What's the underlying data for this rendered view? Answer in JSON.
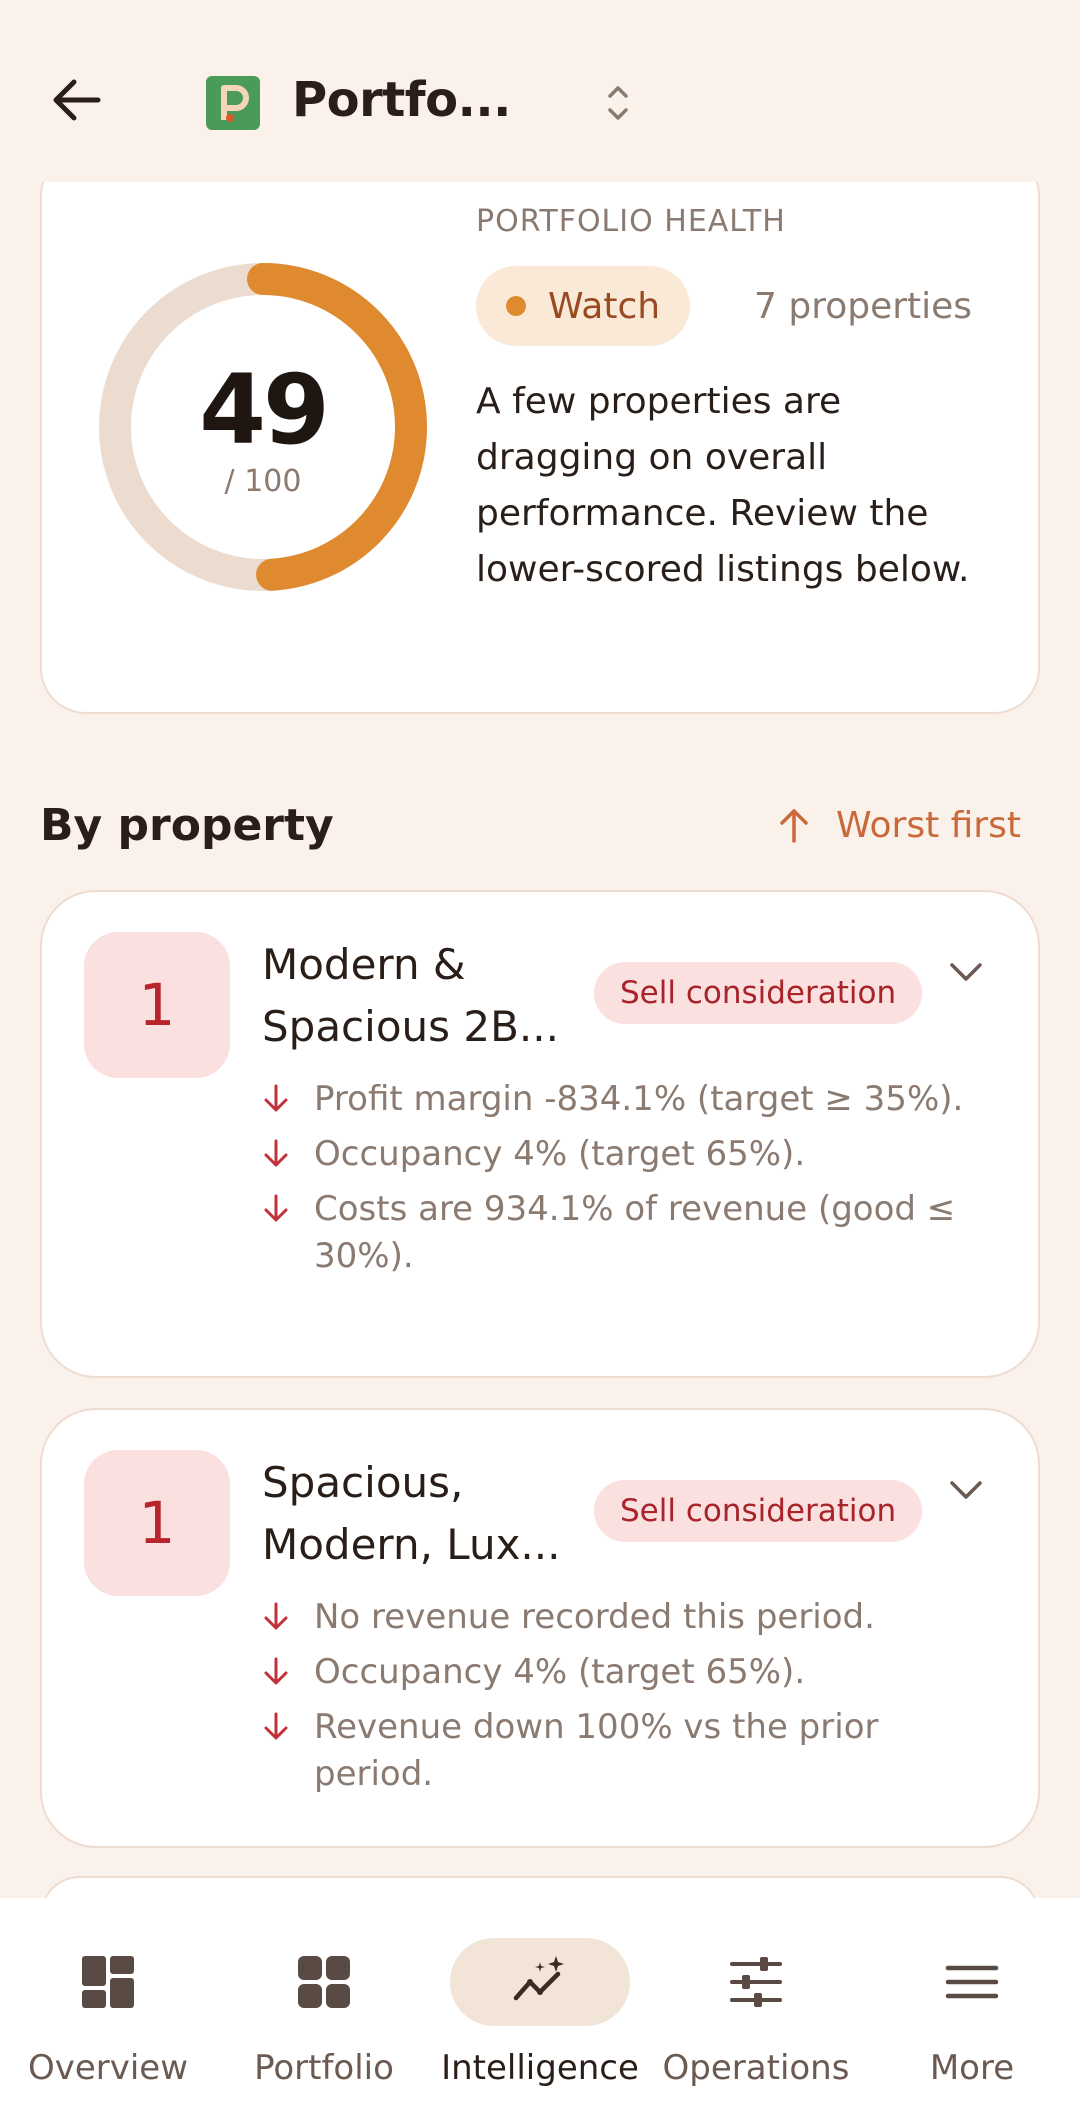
{
  "header": {
    "title": "Portfo..."
  },
  "health": {
    "label": "PORTFOLIO HEALTH",
    "score": "49",
    "max": "/ 100",
    "score_fraction": 0.49,
    "status": "Watch",
    "property_count": "7 properties",
    "description": "A few properties are dragging on overall performance. Review the lower-scored listings below.",
    "colors": {
      "gauge_fill": "#df8a2e",
      "gauge_track": "#ecdccf"
    }
  },
  "section": {
    "title": "By property",
    "sort_label": "Worst first"
  },
  "properties": [
    {
      "rank": "1",
      "name": "Modern & Spacious 2B...",
      "badge": "Sell consideration",
      "reasons": [
        "Profit margin -834.1% (target ≥ 35%).",
        "Occupancy 4% (target 65%).",
        "Costs are 934.1% of revenue (good ≤ 30%)."
      ]
    },
    {
      "rank": "1",
      "name": "Spacious, Modern, Lux...",
      "badge": "Sell consideration",
      "reasons": [
        "No revenue recorded this period.",
        "Occupancy 4% (target 65%).",
        "Revenue down 100% vs the prior period."
      ]
    }
  ],
  "nav": {
    "items": [
      {
        "label": "Overview",
        "icon": "dashboard-icon"
      },
      {
        "label": "Portfolio",
        "icon": "grid-icon"
      },
      {
        "label": "Intelligence",
        "icon": "sparkle-trend-icon"
      },
      {
        "label": "Operations",
        "icon": "sliders-icon"
      },
      {
        "label": "More",
        "icon": "menu-icon"
      }
    ],
    "active": "Intelligence"
  }
}
